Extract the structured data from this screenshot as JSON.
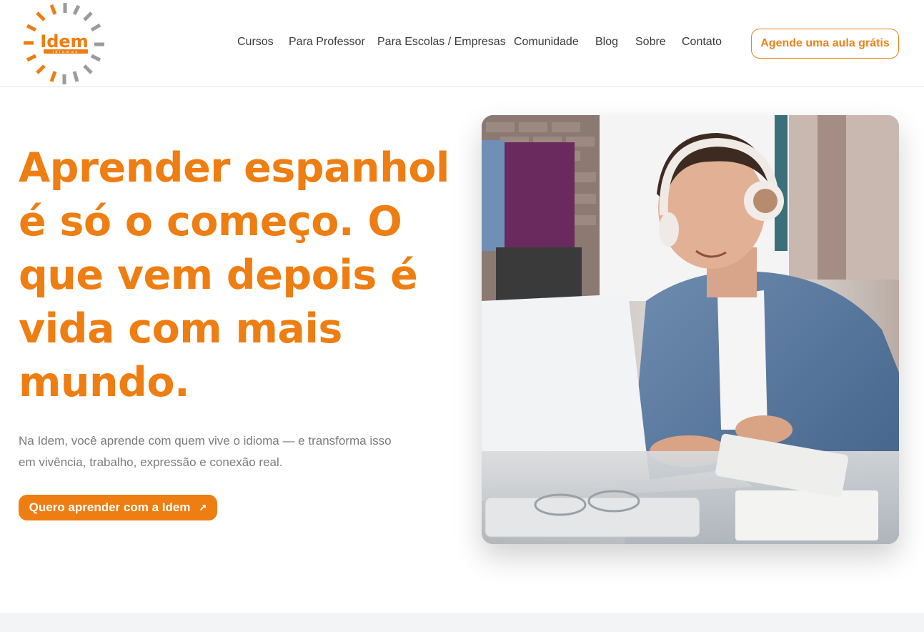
{
  "brand": {
    "name": "Idem",
    "tagline": "idiomas",
    "accent_color": "#ee7d12",
    "secondary_color": "#9b9b9b"
  },
  "nav": {
    "items": [
      {
        "label": "Cursos"
      },
      {
        "label": "Para Professor"
      },
      {
        "label": "Para Escolas / Empresas"
      },
      {
        "label": "Comunidade"
      },
      {
        "label": "Blog"
      },
      {
        "label": "Sobre"
      },
      {
        "label": "Contato"
      }
    ],
    "cta_label": "Agende uma aula grátis"
  },
  "hero": {
    "title_lines": [
      "Aprender espanhol",
      "é só o começo. O",
      "que vem depois é",
      "vida com mais",
      "mundo."
    ],
    "subtitle_lines": [
      "Na Idem, você aprende com quem vive o idioma — e transforma isso",
      "em vivência, trabalho, expressão e conexão real."
    ],
    "button_label": "Quero aprender com a Idem",
    "button_icon": "arrow-up-right-icon",
    "image_subject": "student-with-headphones-laptop"
  }
}
